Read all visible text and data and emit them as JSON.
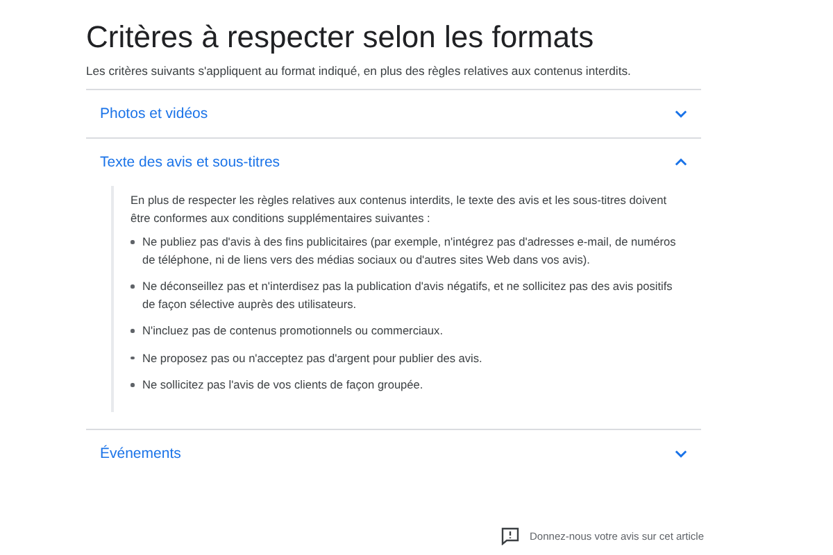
{
  "title": "Critères à respecter selon les formats",
  "intro": "Les critères suivants s'appliquent au format indiqué, en plus des règles relatives aux contenus interdits.",
  "sections": [
    {
      "label": "Photos et vidéos",
      "expanded": false
    },
    {
      "label": "Texte des avis et sous-titres",
      "expanded": true,
      "body": {
        "text": "En plus de respecter les règles relatives aux contenus interdits, le texte des avis et les sous-titres doivent être conformes aux conditions supplémentaires suivantes :",
        "bullets": [
          "Ne publiez pas d'avis à des fins publicitaires (par exemple, n'intégrez pas d'adresses e-mail, de numéros de téléphone, ni de liens vers des médias sociaux ou d'autres sites Web dans vos avis).",
          "Ne déconseillez pas et n'interdisez pas la publication d'avis négatifs, et ne sollicitez pas des avis positifs de façon sélective auprès des utilisateurs.",
          "N'incluez pas de contenus promotionnels ou commerciaux.",
          "Ne proposez pas ou n'acceptez pas d'argent pour publier des avis.",
          "Ne sollicitez pas l'avis de vos clients de façon groupée."
        ]
      }
    },
    {
      "label": "Événements",
      "expanded": false
    }
  ],
  "feedback": "Donnez-nous votre avis sur cet article"
}
